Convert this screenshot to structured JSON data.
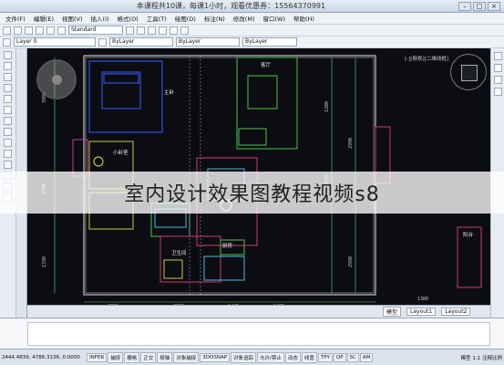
{
  "titlebar": {
    "title": "本课程共10课，每课1小时，观看优惠券：15564370991",
    "min": "–",
    "max": "□",
    "close": "×"
  },
  "toolbar": {
    "layer_select": "Layer 0",
    "color_select": "ByLayer",
    "style_select": "Standard",
    "menu": [
      "文件(F)",
      "编辑(E)",
      "视图(V)",
      "插入(I)",
      "格式(O)",
      "工具(T)",
      "绘图(D)",
      "标注(N)",
      "修改(M)",
      "窗口(W)",
      "帮助(H)"
    ]
  },
  "canvas": {
    "view_label": "[-][俯视][二维线框]"
  },
  "drawing": {
    "labels": [
      "主卧",
      "客厅",
      "小卧室",
      "卫生间",
      "厨房",
      "阳台"
    ],
    "dims": [
      "3900",
      "2740",
      "1330",
      "1200",
      "3405",
      "2990",
      "2980",
      "3850",
      "2900",
      "1440",
      "2405",
      "1380"
    ]
  },
  "watermark": "室内设计效果图教程视频s8",
  "layout_tabs": [
    "模型",
    "Layout1",
    "Layout2"
  ],
  "statusbar": {
    "coords": "2444.4839, 4786.3136, 0.0000",
    "buttons": [
      "INFER",
      "捕捉",
      "栅格",
      "正交",
      "极轴",
      "对象捕捉",
      "3DOSNAP",
      "对象追踪",
      "允许/禁止",
      "动态",
      "线宽",
      "TPY",
      "QP",
      "SC",
      "AM"
    ],
    "right_text": "模型  1:1  注释比例"
  }
}
